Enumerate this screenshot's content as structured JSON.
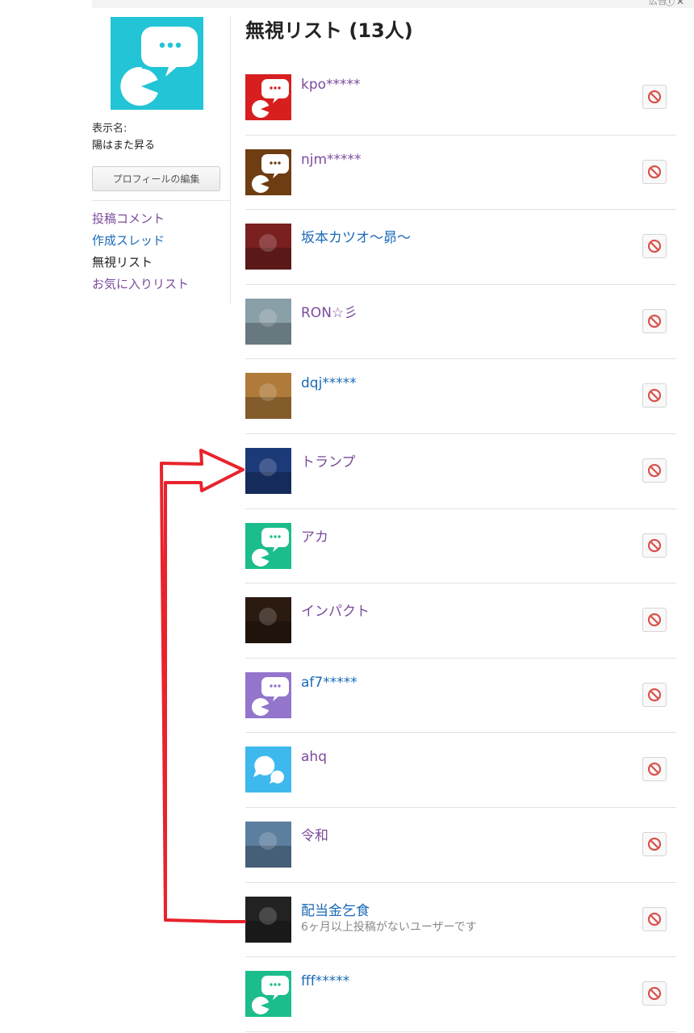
{
  "topbar": {
    "ad_label": "広告"
  },
  "sidebar": {
    "display_name_label": "表示名:",
    "display_name": "陽はまた昇る",
    "edit_profile_label": "プロフィールの編集",
    "nav": [
      {
        "label": "投稿コメント",
        "state": "visited"
      },
      {
        "label": "作成スレッド",
        "state": "link"
      },
      {
        "label": "無視リスト",
        "state": "current"
      },
      {
        "label": "お気に入りリスト",
        "state": "visited"
      }
    ]
  },
  "main": {
    "title": "無視リスト (13人)",
    "users": [
      {
        "name": "kpo*****",
        "avatar": "chat",
        "color": "#d81f1f",
        "state": "visited",
        "note": ""
      },
      {
        "name": "njm*****",
        "avatar": "chat",
        "color": "#6e3d12",
        "state": "visited",
        "note": ""
      },
      {
        "name": "坂本カツオ〜昴〜",
        "avatar": "photo-festival-mask",
        "color": "#7a2020",
        "state": "link",
        "note": ""
      },
      {
        "name": "RON☆彡",
        "avatar": "photo-city-aerial",
        "color": "#8aa0a8",
        "state": "visited",
        "note": ""
      },
      {
        "name": "dqj*****",
        "avatar": "photo-doorway",
        "color": "#b07a3a",
        "state": "link",
        "note": ""
      },
      {
        "name": "トランプ",
        "avatar": "photo-man-suit",
        "color": "#1d3a78",
        "state": "visited",
        "note": ""
      },
      {
        "name": "アカ",
        "avatar": "chat",
        "color": "#1cbd8c",
        "state": "visited",
        "note": ""
      },
      {
        "name": "インパクト",
        "avatar": "photo-meteor",
        "color": "#2a1a10",
        "state": "visited",
        "note": ""
      },
      {
        "name": "af7*****",
        "avatar": "chat",
        "color": "#9375cc",
        "state": "link",
        "note": ""
      },
      {
        "name": "ahq",
        "avatar": "bubbles",
        "color": "#3eb9ee",
        "state": "visited",
        "note": ""
      },
      {
        "name": "令和",
        "avatar": "photo-mountain-lake",
        "color": "#5d7f9f",
        "state": "visited",
        "note": ""
      },
      {
        "name": "配当金乞食",
        "avatar": "photo-gorilla",
        "color": "#222222",
        "state": "link",
        "note": "6ヶ月以上投稿がないユーザーです"
      },
      {
        "name": "fff*****",
        "avatar": "chat",
        "color": "#1cbd8c",
        "state": "link",
        "note": ""
      }
    ]
  },
  "colors": {
    "visited": "#7b4b9c",
    "link": "#1a6ab8",
    "profile_avatar": "#22c4d6",
    "annotation_arrow": "#e8232c",
    "block_icon": "#d9534f"
  },
  "icons": {
    "unblock": "ban-icon",
    "ad_info": "info-icon",
    "ad_close": "close-icon"
  }
}
